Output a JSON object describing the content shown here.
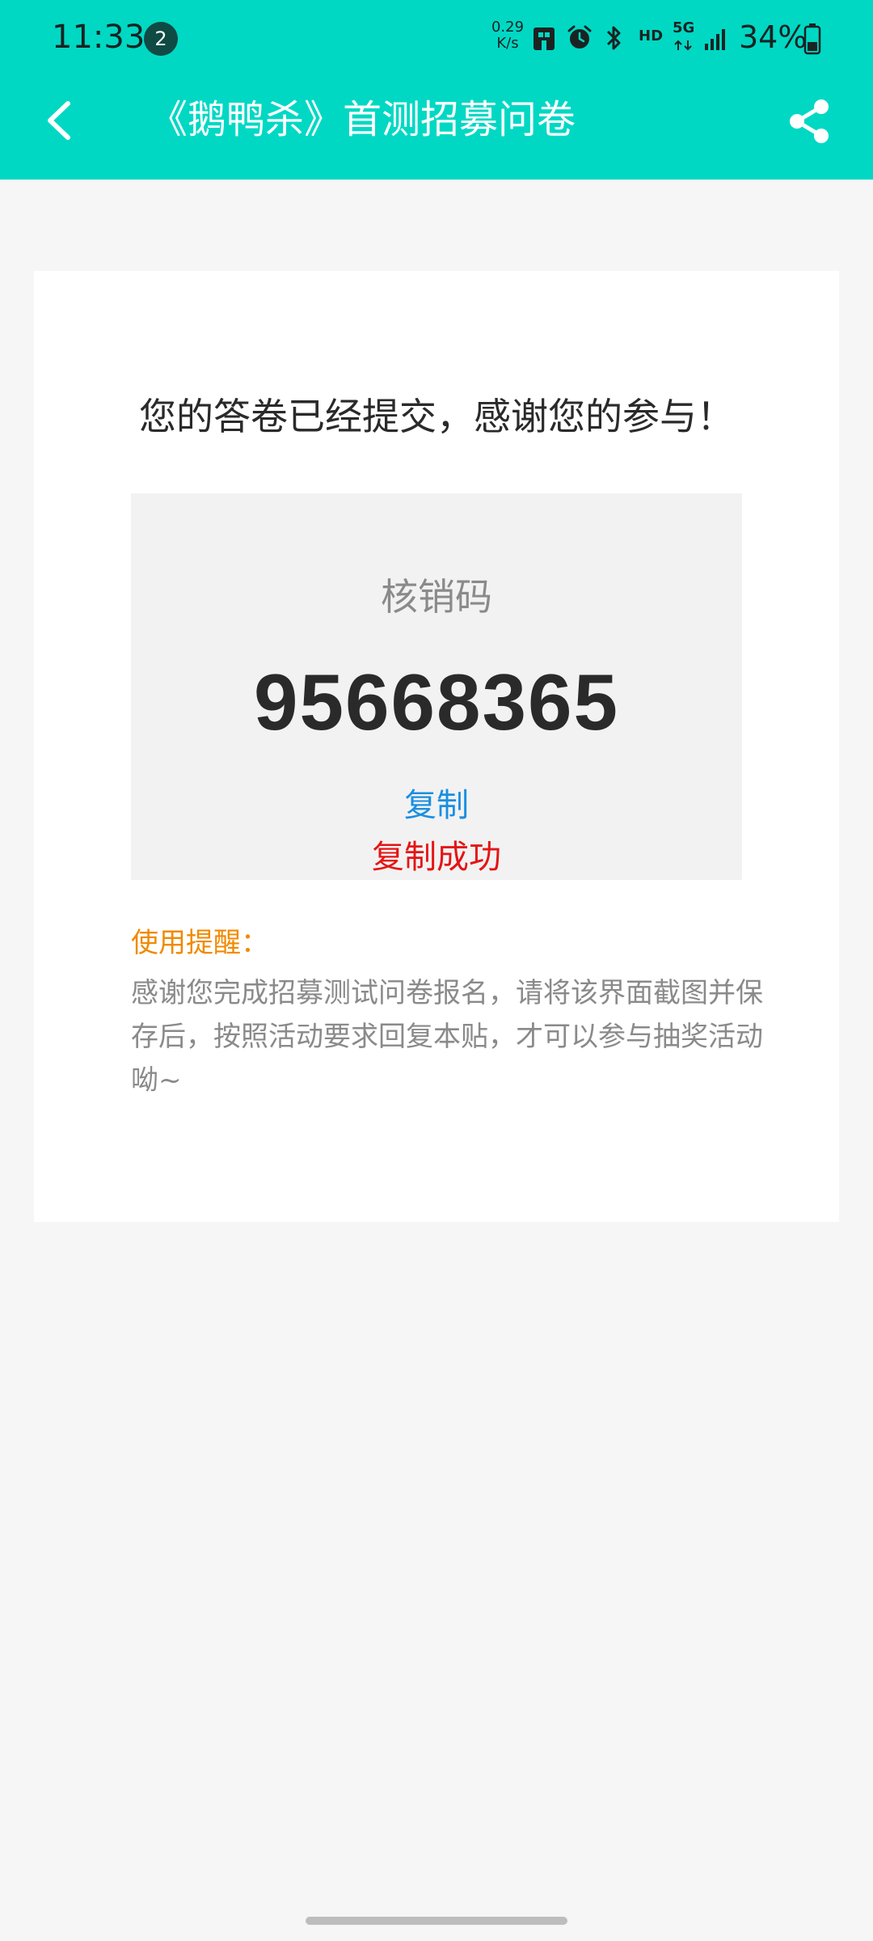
{
  "status_bar": {
    "time": "11:33",
    "notification_count": "2",
    "net_speed_value": "0.29",
    "net_speed_unit": "K/s",
    "hd_label": "HD",
    "network_label": "5G",
    "battery_percent": "34%"
  },
  "app_bar": {
    "title": "《鹅鸭杀》首测招募问卷",
    "back_icon": "chevron-left-icon",
    "share_icon": "share-icon"
  },
  "result": {
    "thanks_message": "您的答卷已经提交，感谢您的参与！",
    "code_label": "核销码",
    "code_value": "95668365",
    "copy_label": "复制",
    "copy_success": "复制成功"
  },
  "reminder": {
    "title": "使用提醒：",
    "text": "感谢您完成招募测试问卷报名，请将该界面截图并保存后，按照活动要求回复本贴，才可以参与抽奖活动呦~"
  },
  "colors": {
    "accent": "#00d8c4",
    "link": "#1a8fe0",
    "success": "#e51414",
    "reminder_title": "#f08a00"
  }
}
